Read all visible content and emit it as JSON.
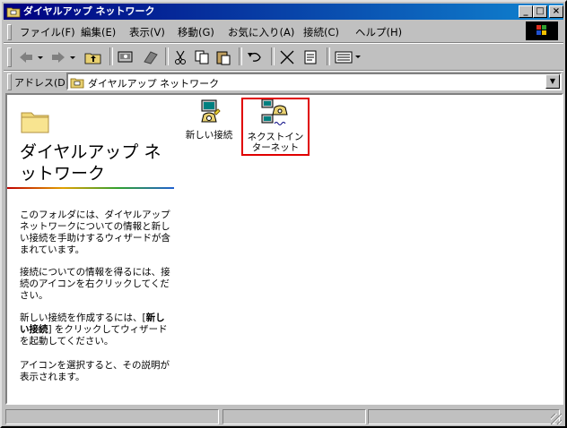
{
  "window": {
    "title": "ダイヤルアップ ネットワーク",
    "minimize_glyph": "_",
    "maximize_glyph": "□",
    "close_glyph": "×"
  },
  "menu": {
    "items": [
      "ファイル(F)",
      "編集(E)",
      "表示(V)",
      "移動(G)",
      "お気に入り(A)",
      "接続(C)",
      "ヘルプ(H)"
    ]
  },
  "toolbar": {
    "back_icon": "back-arrow-icon",
    "forward_icon": "forward-arrow-icon",
    "up_icon": "up-folder-icon",
    "map_drive_icon": "map-network-drive-icon",
    "disconnect_icon": "disconnect-drive-icon",
    "cut_icon": "scissors-icon",
    "copy_icon": "copy-icon",
    "paste_icon": "paste-icon",
    "undo_icon": "undo-icon",
    "delete_icon": "delete-x-icon",
    "properties_icon": "properties-icon",
    "views_icon": "views-icon"
  },
  "address": {
    "label": "アドレス(D)",
    "value": "ダイヤルアップ ネットワーク"
  },
  "left_panel": {
    "title": "ダイヤルアップ ネットワーク",
    "p1": "このフォルダには、ダイヤルアップネットワークについての情報と新しい接続を手助けするウィザードが含まれています。",
    "p2": "接続についての情報を得るには、接続のアイコンを右クリックしてください。",
    "p3_pre": "新しい接続を作成するには、[",
    "p3_bold": "新しい接続",
    "p3_post": "] をクリックしてウィザードを起動してください。",
    "p4": "アイコンを選択すると、その説明が表示されます。"
  },
  "items": [
    {
      "label": "新しい接続",
      "icon": "new-connection-icon"
    },
    {
      "label": "ネクストインターネット",
      "icon": "dialup-connection-icon",
      "selected": true
    }
  ],
  "colors": {
    "titlebar_start": "#000080",
    "titlebar_end": "#1084d0",
    "face": "#c0c0c0",
    "highlight_box": "#e00000"
  }
}
